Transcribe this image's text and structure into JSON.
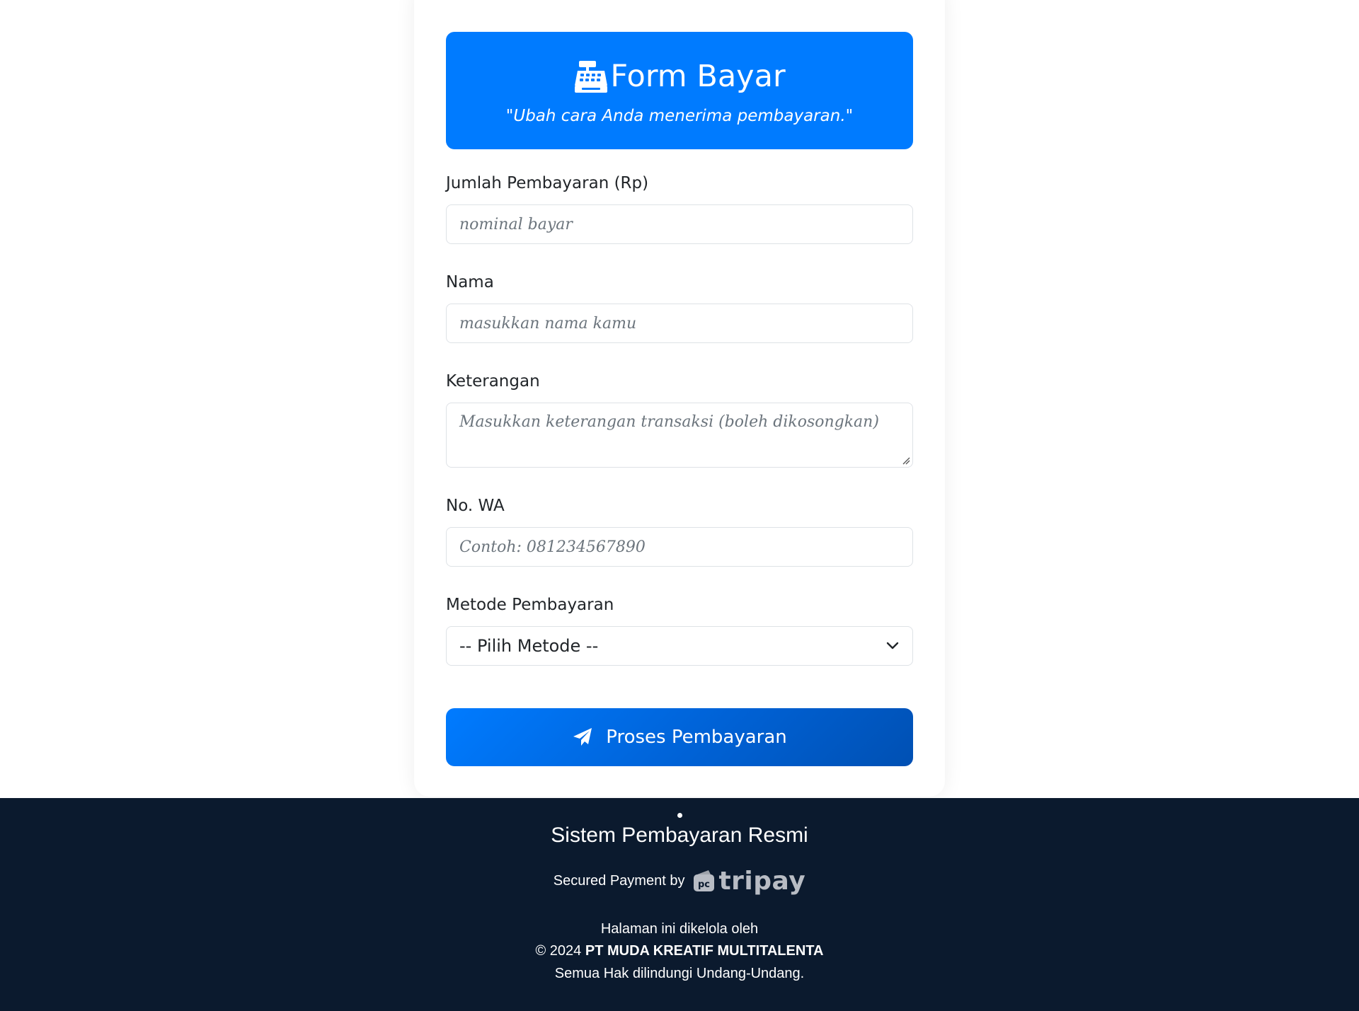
{
  "header": {
    "title": "Form Bayar",
    "tagline": "\"Ubah cara Anda menerima pembayaran.\"",
    "icon": "cash-register-icon"
  },
  "form": {
    "amount": {
      "label": "Jumlah Pembayaran (Rp)",
      "placeholder": "nominal bayar"
    },
    "name": {
      "label": "Nama",
      "placeholder": "masukkan nama kamu"
    },
    "note": {
      "label": "Keterangan",
      "placeholder": "Masukkan keterangan transaksi (boleh dikosongkan)"
    },
    "whatsapp": {
      "label": "No. WA",
      "placeholder": "Contoh: 081234567890"
    },
    "method": {
      "label": "Metode Pembayaran",
      "selected": "-- Pilih Metode --"
    },
    "submit_label": "Proses Pembayaran"
  },
  "footer": {
    "title": "Sistem Pembayaran Resmi",
    "secured_by": "Secured Payment by",
    "logo_text": "tripay",
    "managed_by": "Halaman ini dikelola oleh",
    "copyright_prefix": "© 2024",
    "company": "PT MUDA KREATIF MULTITALENTA",
    "rights": "Semua Hak dilindungi Undang-Undang."
  },
  "colors": {
    "primary": "#007bff",
    "footer_bg": "#0b1a2e",
    "logo_gray": "#b8bcc4"
  }
}
